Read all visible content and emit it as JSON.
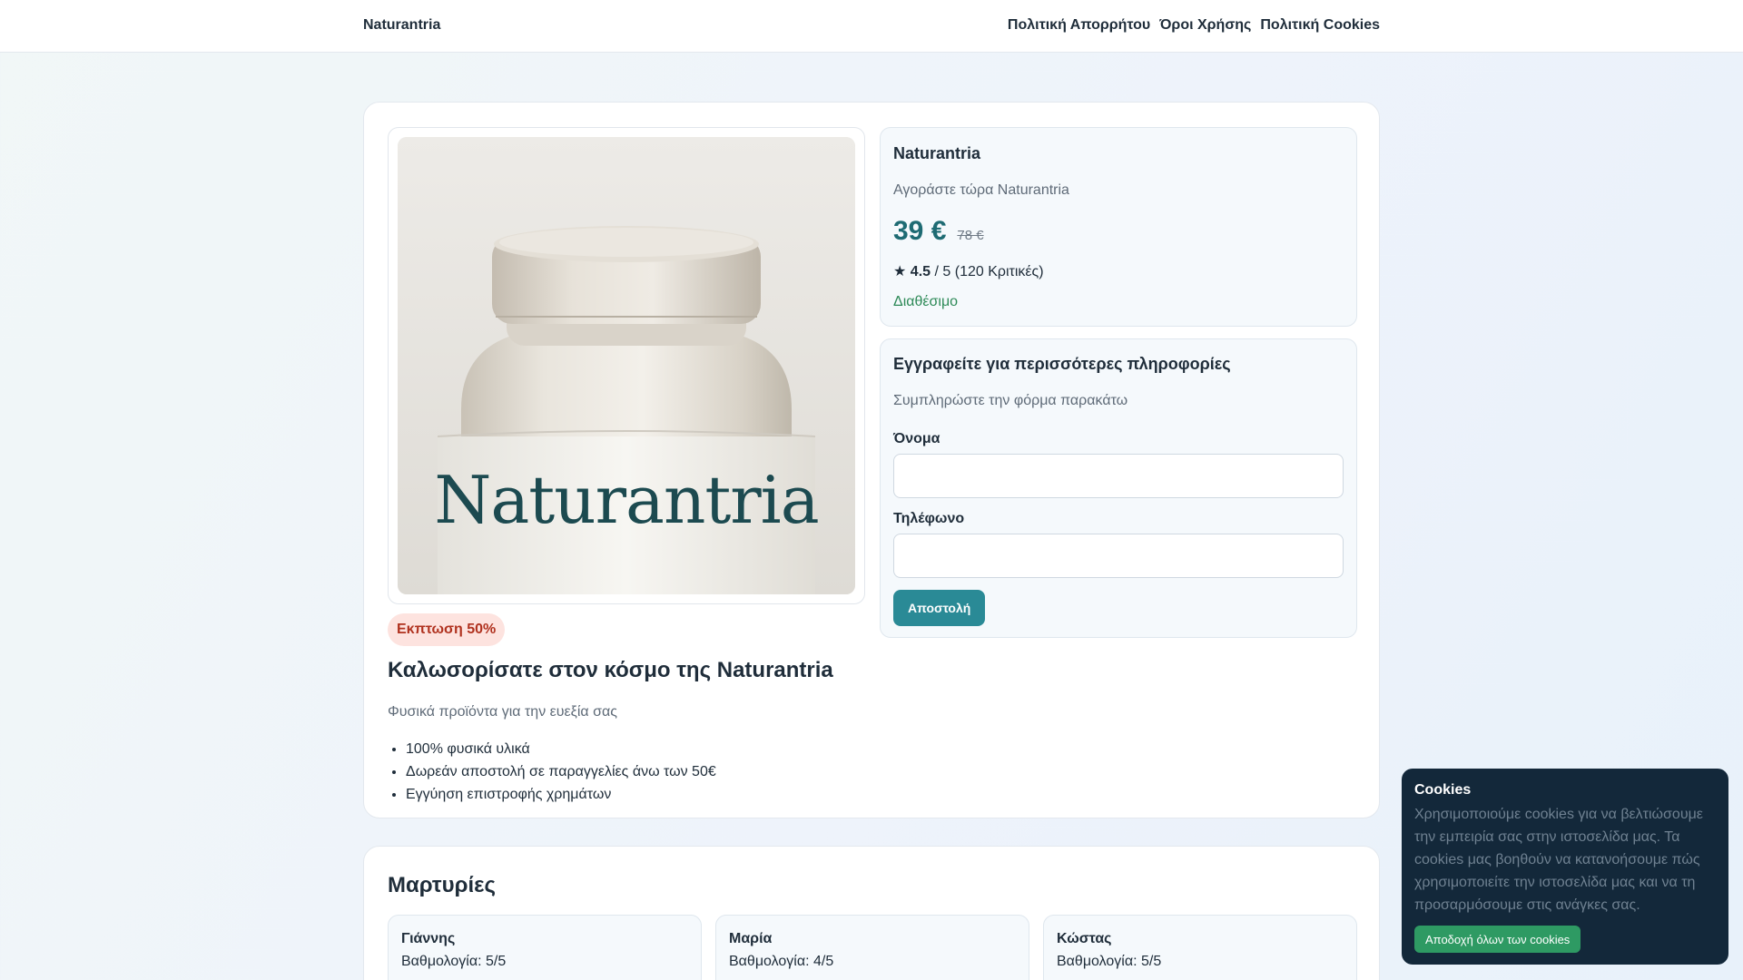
{
  "header": {
    "brand": "Naturantria",
    "nav": [
      {
        "label": "Πολιτική Απορρήτου"
      },
      {
        "label": "Όροι Χρήσης"
      },
      {
        "label": "Πολιτική Cookies"
      }
    ]
  },
  "hero": {
    "image_label": "Naturantria",
    "badge": "Εκπτωση 50%",
    "title": "Καλωσορίσατε στον κόσμο της Naturantria",
    "subtitle": "Φυσικά προϊόντα για την ευεξία σας",
    "features": [
      "100% φυσικά υλικά",
      "Δωρεάν αποστολή σε παραγγελίες άνω των 50€",
      "Εγγύηση επιστροφής χρημάτων"
    ]
  },
  "product": {
    "name": "Naturantria",
    "tagline": "Αγοράστε τώρα Naturantria",
    "price": "39 €",
    "old_price": "78 €",
    "rating_star": "★",
    "rating_value": "4.5",
    "rating_suffix": "/ 5 (120 Κριτικές)",
    "availability": "Διαθέσιμο"
  },
  "form": {
    "title": "Εγγραφείτε για περισσότερες πληροφορίες",
    "subtitle": "Συμπληρώστε την φόρμα παρακάτω",
    "name_label": "Όνομα",
    "name_value": "",
    "phone_label": "Τηλέφωνο",
    "phone_value": "",
    "submit_label": "Αποστολή"
  },
  "testimonials": {
    "title": "Μαρτυρίες",
    "items": [
      {
        "name": "Γιάννης",
        "rating": "Βαθμολογία: 5/5"
      },
      {
        "name": "Μαρία",
        "rating": "Βαθμολογία: 4/5"
      },
      {
        "name": "Κώστας",
        "rating": "Βαθμολογία: 5/5"
      }
    ]
  },
  "cookies": {
    "title": "Cookies",
    "text": "Χρησιμοποιούμε cookies για να βελτιώσουμε την εμπειρία σας στην ιστοσελίδα μας. Τα cookies μας βοηθούν να κατανοήσουμε πώς χρησιμοποιείτε την ιστοσελίδα μας και να τη προσαρμόσουμε στις ανάγκες σας.",
    "accept_label": "Αποδοχή όλων των cookies"
  },
  "colors": {
    "accent": "#2a8a96",
    "price": "#1e6b73",
    "available": "#2e8a58",
    "badge_bg": "#fde3df",
    "badge_text": "#b0321f",
    "cookie_bg": "#13283a",
    "cookie_button": "#2e9a63"
  }
}
